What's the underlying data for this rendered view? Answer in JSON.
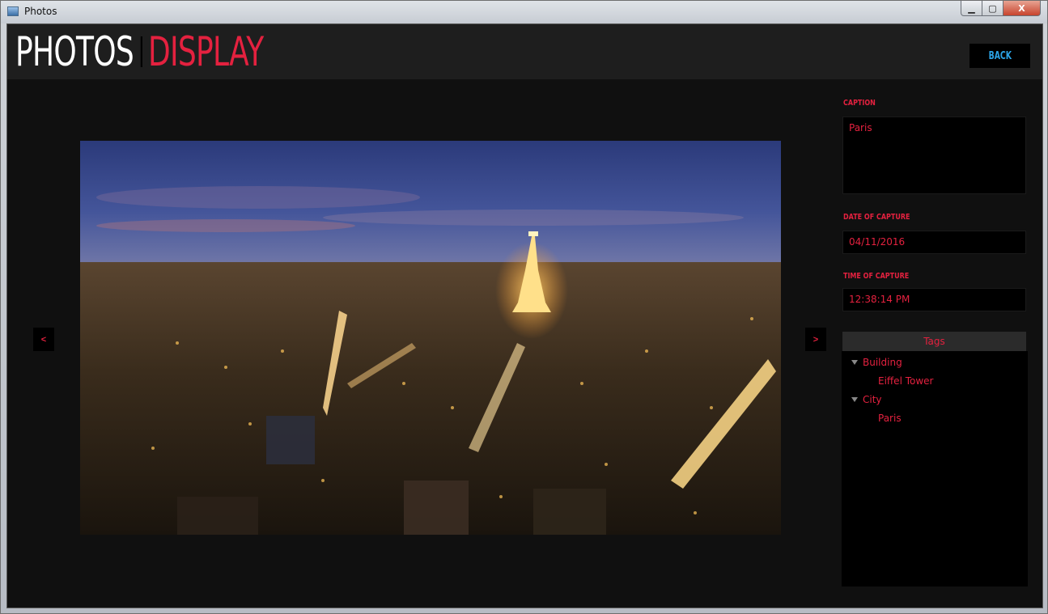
{
  "window": {
    "title": "Photos",
    "controls": {
      "minimize": "▁",
      "maximize": "▢",
      "close": "X"
    }
  },
  "header": {
    "title_part1": "PHOTOS",
    "title_part2": "DISPLAY",
    "back_label": "BACK"
  },
  "viewer": {
    "prev_label": "<",
    "next_label": ">",
    "image_alt": "Paris at night with the Eiffel Tower"
  },
  "details": {
    "caption_label": "CAPTION",
    "caption_value": "Paris",
    "date_label": "DATE OF CAPTURE",
    "date_value": "04/11/2016",
    "time_label": "TIME OF CAPTURE",
    "time_value": "12:38:14 PM"
  },
  "tags": {
    "header": "Tags",
    "groups": [
      {
        "label": "Building",
        "children": [
          "Eiffel Tower"
        ]
      },
      {
        "label": "City",
        "children": [
          "Paris"
        ]
      }
    ]
  },
  "colors": {
    "accent_red": "#e4213f",
    "accent_blue": "#2ba3e6",
    "background": "#101010",
    "header_bg": "#1e1e1e"
  }
}
